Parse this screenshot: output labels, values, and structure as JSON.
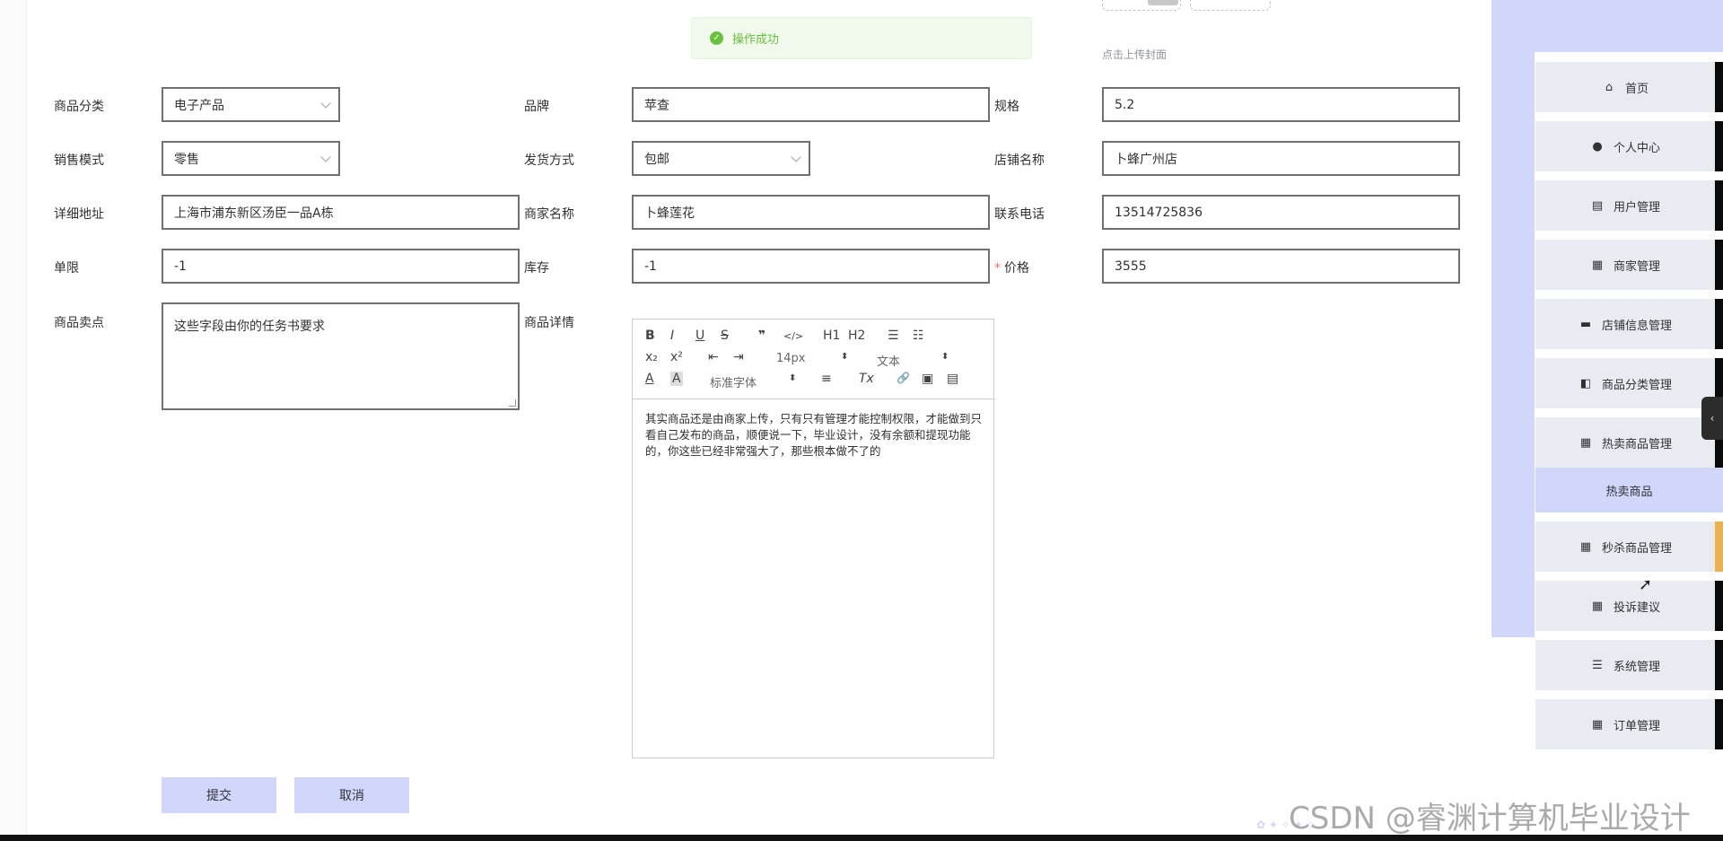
{
  "toast": {
    "message": "操作成功"
  },
  "upload": {
    "hint": "点击上传封面"
  },
  "form": {
    "category": {
      "label": "商品分类",
      "value": "电子产品"
    },
    "brand": {
      "label": "品牌",
      "value": "苹查"
    },
    "spec": {
      "label": "规格",
      "value": "5.2"
    },
    "sale_mode": {
      "label": "销售模式",
      "value": "零售"
    },
    "shipping": {
      "label": "发货方式",
      "value": "包邮"
    },
    "shop_name": {
      "label": "店铺名称",
      "value": "卜蜂广州店"
    },
    "address": {
      "label": "详细地址",
      "value": "上海市浦东新区汤臣一品A栋"
    },
    "merchant_name": {
      "label": "商家名称",
      "value": "卜蜂莲花"
    },
    "phone": {
      "label": "联系电话",
      "value": "13514725836"
    },
    "limit": {
      "label": "单限",
      "value": "-1"
    },
    "stock": {
      "label": "库存",
      "value": "-1"
    },
    "price": {
      "label": "价格",
      "value": "3555",
      "required_mark": "*"
    },
    "selling_point": {
      "label": "商品卖点",
      "value": "这些字段由你的任务书要求"
    },
    "detail": {
      "label": "商品详情"
    }
  },
  "editor": {
    "toolbar": {
      "bold": "B",
      "italic": "I",
      "underline": "U",
      "strike": "S",
      "quote": "❞",
      "code": "</>",
      "h1": "H1",
      "h2": "H2",
      "ordered_list": "☰",
      "bullet_list": "☷",
      "sub": "x₂",
      "sup": "x²",
      "outdent": "⇤",
      "indent": "⇥",
      "size": "14px",
      "header": "文本",
      "color": "A",
      "background": "A",
      "font": "标准字体",
      "align": "≡",
      "clean": "Tx",
      "link": "🔗",
      "image": "▣",
      "video": "▤"
    },
    "content": "其实商品还是由商家上传，只有只有管理才能控制权限，才能做到只看自己发布的商品，顺便说一下，毕业设计，没有余额和提现功能的，你这些已经非常强大了，那些根本做不了的"
  },
  "buttons": {
    "submit": "提交",
    "cancel": "取消"
  },
  "sidebar": {
    "items": [
      {
        "label": "首页",
        "icon": "home-icon"
      },
      {
        "label": "个人中心",
        "icon": "user-icon"
      },
      {
        "label": "用户管理",
        "icon": "clipboard-icon"
      },
      {
        "label": "商家管理",
        "icon": "grid-icon"
      },
      {
        "label": "店铺信息管理",
        "icon": "briefcase-icon"
      },
      {
        "label": "商品分类管理",
        "icon": "wallet-icon"
      },
      {
        "label": "热卖商品管理",
        "icon": "grid-icon"
      },
      {
        "label": "秒杀商品管理",
        "icon": "grid-icon"
      },
      {
        "label": "投诉建议",
        "icon": "grid-icon"
      },
      {
        "label": "系统管理",
        "icon": "list-icon"
      },
      {
        "label": "订单管理",
        "icon": "grid-icon"
      }
    ],
    "submenu": {
      "label": "热卖商品"
    },
    "active_color": "#e8b34f"
  },
  "watermark": "CSDN @睿渊计算机毕业设计"
}
